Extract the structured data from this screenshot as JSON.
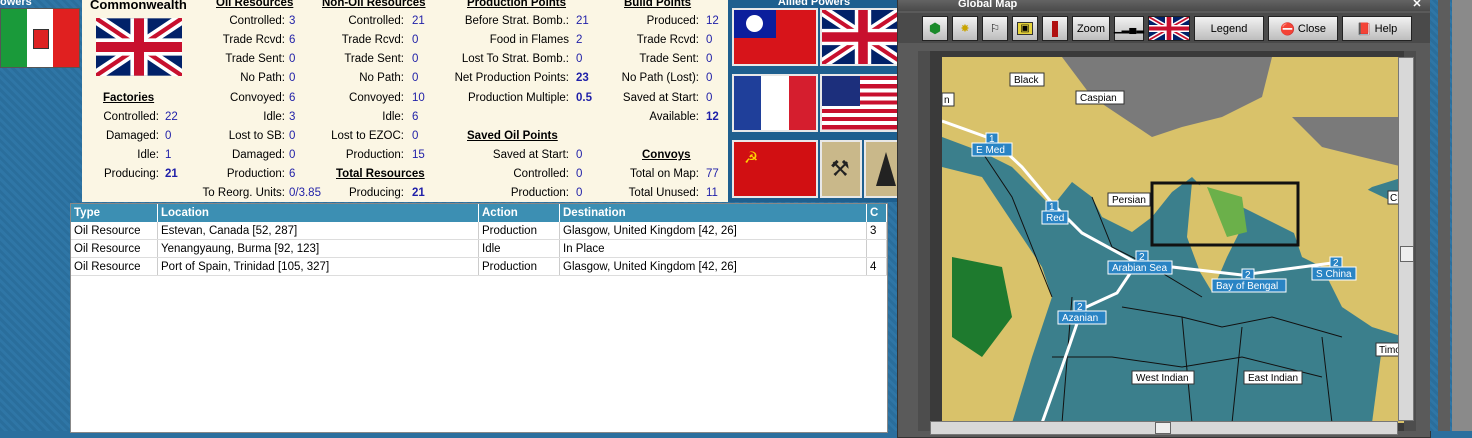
{
  "left_panel": {
    "header": "owers"
  },
  "report": {
    "nation_title": "Commonwealth",
    "factories": {
      "heading": "Factories",
      "rows": [
        {
          "label": "Controlled:",
          "value": "22"
        },
        {
          "label": "Damaged:",
          "value": "0"
        },
        {
          "label": "Idle:",
          "value": "1"
        },
        {
          "label": "Producing:",
          "value": "21"
        }
      ]
    },
    "oil_resources": {
      "heading": "Oil Resources",
      "rows": [
        {
          "label": "Controlled:",
          "value": "3"
        },
        {
          "label": "Trade Rcvd:",
          "value": "6"
        },
        {
          "label": "Trade Sent:",
          "value": "0"
        },
        {
          "label": "No Path:",
          "value": "0"
        },
        {
          "label": "Convoyed:",
          "value": "6"
        },
        {
          "label": "Idle:",
          "value": "3"
        },
        {
          "label": "Lost to SB:",
          "value": "0"
        },
        {
          "label": "Damaged:",
          "value": "0"
        },
        {
          "label": "Production:",
          "value": "6"
        },
        {
          "label": "To Reorg. Units:",
          "value": "0/3.85"
        }
      ]
    },
    "non_oil_resources": {
      "heading": "Non-Oil Resources",
      "rows": [
        {
          "label": "Controlled:",
          "value": "21"
        },
        {
          "label": "Trade Rcvd:",
          "value": "0"
        },
        {
          "label": "Trade Sent:",
          "value": "0"
        },
        {
          "label": "No Path:",
          "value": "0"
        },
        {
          "label": "Convoyed:",
          "value": "10"
        },
        {
          "label": "Idle:",
          "value": "6"
        },
        {
          "label": "Lost to EZOC:",
          "value": "0"
        },
        {
          "label": "Production:",
          "value": "15"
        }
      ]
    },
    "total_resources": {
      "heading": "Total Resources",
      "producing_label": "Producing:",
      "producing_value": "21"
    },
    "production_points": {
      "heading": "Production Points",
      "rows": [
        {
          "label": "Before Strat. Bomb.:",
          "value": "21"
        },
        {
          "label": "Food in Flames",
          "value": "2"
        },
        {
          "label": "Lost To Strat. Bomb.:",
          "value": "0"
        },
        {
          "label": "Net Production Points:",
          "value": "23"
        },
        {
          "label": "Production Multiple:",
          "value": "0.5"
        }
      ]
    },
    "saved_oil_points": {
      "heading": "Saved Oil Points",
      "rows": [
        {
          "label": "Saved at Start:",
          "value": "0"
        },
        {
          "label": "Controlled:",
          "value": "0"
        },
        {
          "label": "Production:",
          "value": "0"
        }
      ]
    },
    "build_points": {
      "heading": "Build Points",
      "rows": [
        {
          "label": "Produced:",
          "value": "12"
        },
        {
          "label": "Trade Rcvd:",
          "value": "0"
        },
        {
          "label": "Trade Sent:",
          "value": "0"
        },
        {
          "label": "No Path (Lost):",
          "value": "0"
        },
        {
          "label": "Saved at Start:",
          "value": "0"
        },
        {
          "label": "Available:",
          "value": "12"
        }
      ]
    },
    "convoys": {
      "heading": "Convoys",
      "rows": [
        {
          "label": "Total on Map:",
          "value": "77"
        },
        {
          "label": "Total Unused:",
          "value": "11"
        }
      ]
    }
  },
  "allied": {
    "header": "Allied Powers"
  },
  "resource_table": {
    "columns": [
      "Type",
      "Location",
      "Action",
      "Destination",
      "C"
    ],
    "rows": [
      [
        "Oil Resource",
        "Estevan, Canada [52, 287]",
        "Production",
        "Glasgow, United Kingdom [42, 26]",
        "3"
      ],
      [
        "Oil Resource",
        "Yenangyaung, Burma [92, 123]",
        "Idle",
        "In Place",
        ""
      ],
      [
        "Oil Resource",
        "Port of Spain, Trinidad [105, 327]",
        "Production",
        "Glasgow, United Kingdom [42, 26]",
        "4"
      ]
    ]
  },
  "global_map": {
    "title": "Global Map",
    "toolbar": {
      "zoom": "Zoom",
      "legend": "Legend",
      "close": "Close",
      "help": "Help"
    },
    "labels": {
      "black": "Black",
      "caspian": "Caspian",
      "e_med": "E Med",
      "red": "Red",
      "persian": "Persian",
      "arabian_sea": "Arabian Sea",
      "bay_of_bengal": "Bay of Bengal",
      "s_china": "S China",
      "azanian": "Azanian",
      "west_indian": "West Indian",
      "east_indian": "East Indian",
      "ch": "Ch",
      "timo": "Timo",
      "n": "n"
    },
    "convoy_counts": {
      "e_med": "1",
      "red": "1",
      "arabian_sea": "2",
      "bay_of_bengal": "2",
      "s_china": "2",
      "azanian": "2"
    }
  },
  "colors": {
    "panel_bg": "#fbf6e4",
    "value_blue": "#1f1fa8",
    "table_header": "#3c8fb3",
    "sea": "#3b7f8c",
    "land": "#d9c26a"
  }
}
